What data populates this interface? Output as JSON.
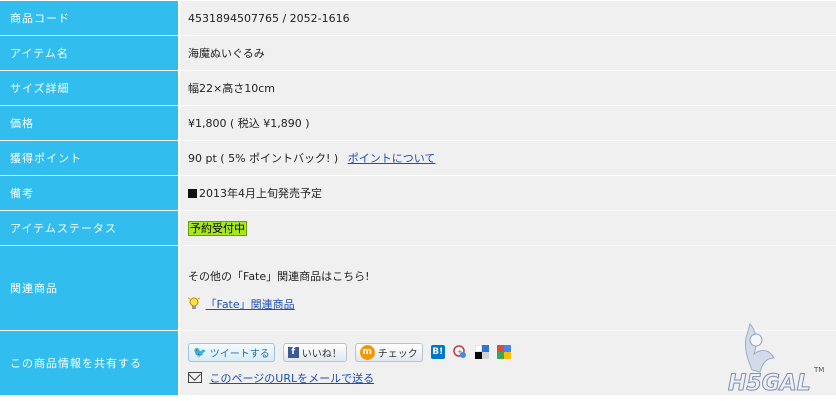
{
  "rows": {
    "code": {
      "label": "商品コード",
      "value": "4531894507765 / 2052-1616"
    },
    "item": {
      "label": "アイテム名",
      "value": "海魔ぬいぐるみ"
    },
    "size": {
      "label": "サイズ詳細",
      "value": "幅22×高さ10cm"
    },
    "price": {
      "label": "価格",
      "value": "¥1,800 ( 税込 ¥1,890 )"
    },
    "points": {
      "label": "獲得ポイント",
      "value": "90 pt ( 5% ポイントバック! )",
      "link": "ポイントについて"
    },
    "note": {
      "label": "備考",
      "value": "2013年4月上旬発売予定"
    },
    "status": {
      "label": "アイテムステータス",
      "badge": "予約受付中"
    },
    "related": {
      "label": "関連商品",
      "text": "その他の「Fate」関連商品はこちら!",
      "link": "「Fate」関連商品"
    },
    "share": {
      "label": "この商品情報を共有する",
      "tweet": "ツイートする",
      "like": "いいね！",
      "check": "チェック",
      "hatena": "B!",
      "mail_link": "このページのURLをメールで送る"
    }
  },
  "watermark": {
    "text": "H5GAL",
    "tm": "TM"
  },
  "colors": {
    "label_bg": "#31bdee",
    "value_bg": "#f0f0f0",
    "link": "#1f4fb4",
    "badge": "#a8e61f"
  }
}
